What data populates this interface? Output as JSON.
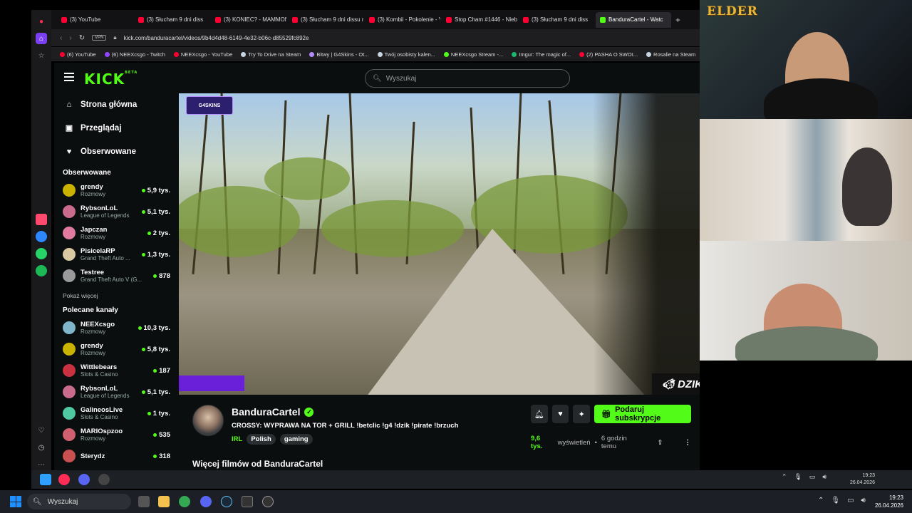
{
  "browser": {
    "tabs": [
      {
        "label": "(3) YouTube",
        "color": "#ff0033"
      },
      {
        "label": "(3) Słucham 9 dni diss",
        "color": "#ff0033"
      },
      {
        "label": "(3) KONIEC? - MAMMON",
        "color": "#ff0033"
      },
      {
        "label": "(3) Słucham 9 dni dissu na",
        "color": "#ff0033"
      },
      {
        "label": "(3) Kombii - Pokolenie - Y",
        "color": "#ff0033"
      },
      {
        "label": "Stop Cham #1446 - Niebe",
        "color": "#ff0033"
      },
      {
        "label": "(3) Słucham 9 dni diss",
        "color": "#ff0033"
      },
      {
        "label": "BanduraCartel - Watc",
        "color": "#53fc18"
      }
    ],
    "url": "kick.com/banduracartel/videos/9b4d4d48-6149-4e32-b06c-d85529fc892e",
    "vpn_label": "VPN",
    "bookmarks": [
      {
        "label": "(6) YouTube",
        "color": "#ff0033"
      },
      {
        "label": "(6) NEEXcsgo - Twitch",
        "color": "#9146ff"
      },
      {
        "label": "NEEXcsgo - YouTube",
        "color": "#ff0033"
      },
      {
        "label": "Try To Drive na Steam",
        "color": "#c7d5e0"
      },
      {
        "label": "Bitwy | G4Skins - Ot...",
        "color": "#b48cff"
      },
      {
        "label": "Twój osobisty kalen...",
        "color": "#c7d5e0"
      },
      {
        "label": "NEEXcsgo Stream -...",
        "color": "#53fc18"
      },
      {
        "label": "Imgur: The magic of...",
        "color": "#1bb76e"
      },
      {
        "label": "(2) PASHA O SWOI...",
        "color": "#ff0033"
      },
      {
        "label": "Rosalie na Steam",
        "color": "#c7d5e0"
      }
    ]
  },
  "kick": {
    "logo": "KICK",
    "logo_beta": "BETA",
    "search_placeholder": "Wyszukaj",
    "nav": [
      {
        "label": "Strona główna",
        "icon": "home-icon"
      },
      {
        "label": "Przeglądaj",
        "icon": "browse-icon"
      },
      {
        "label": "Obserwowane",
        "icon": "heart-icon"
      }
    ],
    "followed_title": "Obserwowane",
    "followed": [
      {
        "name": "grendy",
        "category": "Rozmowy",
        "viewers": "5,9 tys.",
        "color": "#c9b200"
      },
      {
        "name": "RybsonLoL",
        "category": "League of Legends",
        "viewers": "5,1 tys.",
        "color": "#c96b8a"
      },
      {
        "name": "Japczan",
        "category": "Rozmowy",
        "viewers": "2 tys.",
        "color": "#e07aa0"
      },
      {
        "name": "PisicelaRP",
        "category": "Grand Theft Auto ...",
        "viewers": "1,3 tys.",
        "color": "#d8c9a0"
      },
      {
        "name": "Testree",
        "category": "Grand Theft Auto V (G...",
        "viewers": "878",
        "color": "#9a9a9a"
      }
    ],
    "show_more": "Pokaż więcej",
    "recommended_title": "Polecane kanały",
    "recommended": [
      {
        "name": "NEEXcsgo",
        "category": "Rozmowy",
        "viewers": "10,3 tys.",
        "color": "#7fb5c9"
      },
      {
        "name": "grendy",
        "category": "Rozmowy",
        "viewers": "5,8 tys.",
        "color": "#c9b200"
      },
      {
        "name": "Wittlebears",
        "category": "Slots & Casino",
        "viewers": "187",
        "color": "#c93040"
      },
      {
        "name": "RybsonLoL",
        "category": "League of Legends",
        "viewers": "5,1 tys.",
        "color": "#c96b8a"
      },
      {
        "name": "GalineosLive",
        "category": "Slots & Casino",
        "viewers": "1 tys.",
        "color": "#4fc9a0"
      },
      {
        "name": "MARIOspzoo",
        "category": "Rozmowy",
        "viewers": "535",
        "color": "#d06070"
      },
      {
        "name": "Sterydz",
        "category": "",
        "viewers": "318",
        "color": "#c95050"
      }
    ],
    "video": {
      "sponsor_badge": "G4SKINS",
      "overlay_brand": "DZIK"
    },
    "channel": {
      "name": "BanduraCartel",
      "title": "CROSSY: WYPRAWA NA TOR + GRILL !betclic !g4 !dzik !pirate !brzuch",
      "category": "IRL",
      "tags": [
        "Polish",
        "gaming"
      ],
      "views": "9,6 tys.",
      "views_label": "wyświetleń",
      "ago": "6 godzin temu",
      "subscribe_label": "Podaruj subskrypcje"
    },
    "more_videos": "Więcej filmów od BanduraCartel"
  },
  "overlay": {
    "cam_logo": "ELDER"
  },
  "taskbar": {
    "search_label": "Wyszukaj",
    "inner_time": "19:23",
    "inner_date": "26.04.2026",
    "time": "19:23",
    "date": "26.04.2026"
  }
}
